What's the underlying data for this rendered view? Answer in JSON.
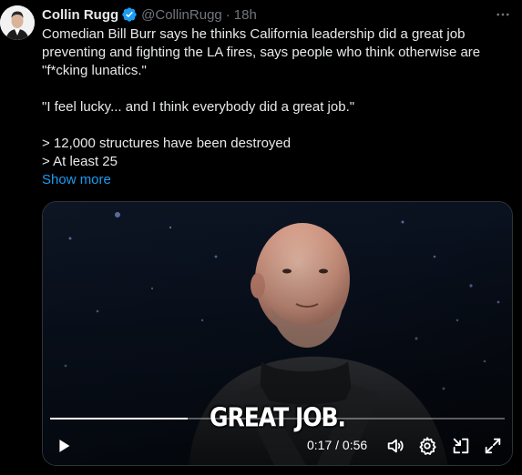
{
  "author": {
    "display_name": "Collin Rugg",
    "handle": "@CollinRugg",
    "separator": "·",
    "time": "18h",
    "verified": true
  },
  "tweet": {
    "paragraphs": [
      "Comedian Bill Burr says he thinks California leadership did a great job preventing and fighting the LA fires, says people who think otherwise are \"f*cking lunatics.\"",
      "\"I feel lucky... and I think everybody did a great job.\"",
      "> 12,000 structures have been destroyed\n> At least 25"
    ],
    "show_more": "Show more"
  },
  "video": {
    "caption": "GREAT JOB.",
    "timecode": "0:17 / 0:56",
    "progress": 0.303
  },
  "icons": {
    "more": "more-icon",
    "verified": "verified-badge-icon",
    "play": "play-icon",
    "volume": "volume-icon",
    "settings": "gear-icon",
    "pip": "picture-in-picture-icon",
    "fullscreen": "fullscreen-icon"
  },
  "colors": {
    "background": "#000000",
    "text": "#e7e9ea",
    "muted": "#71767b",
    "link": "#1d9bf0",
    "verified": "#1d9bf0"
  }
}
